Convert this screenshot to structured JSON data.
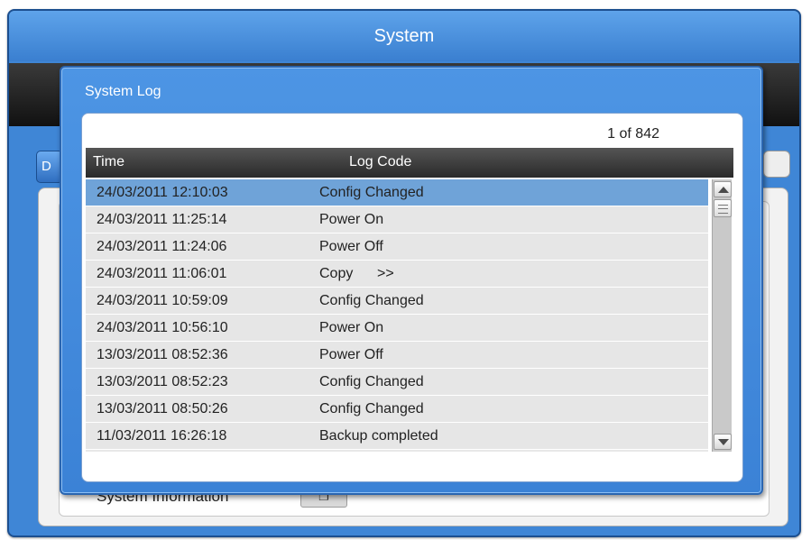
{
  "background_window": {
    "title": "System",
    "tab_partial_label": "D",
    "system_information_label": "System Information",
    "system_information_button_icon": "window-icon"
  },
  "dialog": {
    "title": "System Log",
    "page_indicator": "1 of 842",
    "columns": [
      "Time",
      "Log Code"
    ],
    "selected_row_index": 0,
    "rows": [
      {
        "time": "24/03/2011 12:10:03",
        "code": "Config Changed"
      },
      {
        "time": "24/03/2011 11:25:14",
        "code": "Power On"
      },
      {
        "time": "24/03/2011 11:24:06",
        "code": "Power Off"
      },
      {
        "time": "24/03/2011 11:06:01",
        "code": "Copy      >>"
      },
      {
        "time": "24/03/2011 10:59:09",
        "code": "Config Changed"
      },
      {
        "time": "24/03/2011 10:56:10",
        "code": "Power On"
      },
      {
        "time": "13/03/2011 08:52:36",
        "code": "Power Off"
      },
      {
        "time": "13/03/2011 08:52:23",
        "code": "Config Changed"
      },
      {
        "time": "13/03/2011 08:50:26",
        "code": "Config Changed"
      },
      {
        "time": "11/03/2011 16:26:18",
        "code": "Backup completed"
      }
    ]
  },
  "colors": {
    "accent_blue": "#3f86d6",
    "selected_row": "#6fa3d8",
    "header_dark": "#2a2a2a"
  }
}
